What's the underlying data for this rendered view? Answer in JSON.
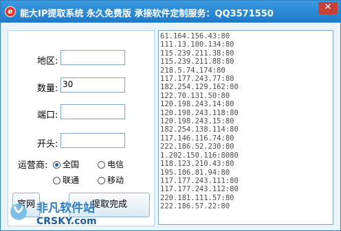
{
  "window": {
    "title": "能大IP提取系统 永久免费版 承接软件定制服务：QQ3571550",
    "icon_label": "e",
    "close_symbol": "✕"
  },
  "form": {
    "region_label": "地区:",
    "region_value": "",
    "count_label": "数量:",
    "count_value": "30",
    "port_label": "端口:",
    "port_value": "",
    "prefix_label": "开头:",
    "prefix_value": "",
    "carrier_label": "运营商:",
    "carriers": [
      {
        "label": "全国",
        "selected": true
      },
      {
        "label": "电信",
        "selected": false
      },
      {
        "label": "联通",
        "selected": false
      },
      {
        "label": "移动",
        "selected": false
      }
    ]
  },
  "buttons": {
    "homepage_label": "官网",
    "extract_label": "提取完成"
  },
  "ip_list": [
    "61.164.156.43:80",
    "111.13.100.134:80",
    "115.239.211.38:80",
    "115.239.211.88:80",
    "218.5.74.174:80",
    "117.177.243.77:80",
    "182.254.129.162:80",
    "122.70.131.50:80",
    "120.198.243.14:80",
    "120.198.243.118:80",
    "120.198.243.15:80",
    "182.254.138.114:80",
    "117.146.116.74:80",
    "222.186.52.230:80",
    "1.202.150.116:8080",
    "118.123.210.43:80",
    "195.186.81.94:80",
    "117.177.243.111:80",
    "117.177.243.112:80",
    "220.181.111.57:80",
    "222.186.57.22:80"
  ],
  "watermark": {
    "text_cn": "非凡软件站",
    "text_en": "CRSKY.com"
  }
}
